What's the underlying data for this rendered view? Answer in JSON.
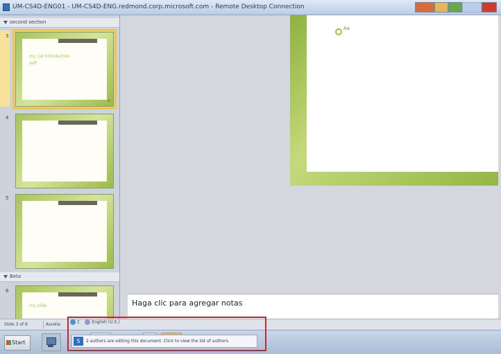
{
  "window": {
    "title": "UM-CS4D-ENG01 - UM-CS4D-ENG.redmond.corp.microsoft.com - Remote Desktop Connection",
    "rdp_icon": "remote-desktop-icon"
  },
  "sections": [
    {
      "name": "second section",
      "collapsed": false
    },
    {
      "name": "Beta",
      "collapsed": false
    }
  ],
  "slides": [
    {
      "number": "3",
      "selected": true,
      "title_text": "my 1st introduction",
      "sub_text": "self",
      "badge": "e"
    },
    {
      "number": "4",
      "selected": false
    },
    {
      "number": "5",
      "selected": false
    },
    {
      "number": "6",
      "selected": false,
      "title_text": "my slide"
    }
  ],
  "slide_editor": {
    "bullet_text": "Aa"
  },
  "notes": {
    "placeholder": "Haga clic para agregar notas"
  },
  "statusbar": {
    "slide_count": "Slide 3 of 6",
    "theme": "Aurelia",
    "coauthors_count": "2",
    "language": "English (U.S.)"
  },
  "taskbar": {
    "start_label": "Start"
  },
  "notification": {
    "text": "2 authors are editing this document. Click to view the list of authors."
  },
  "colors": {
    "highlight": "#c4262d",
    "slide_green": "#9cbb48",
    "selection": "#f5c542"
  }
}
